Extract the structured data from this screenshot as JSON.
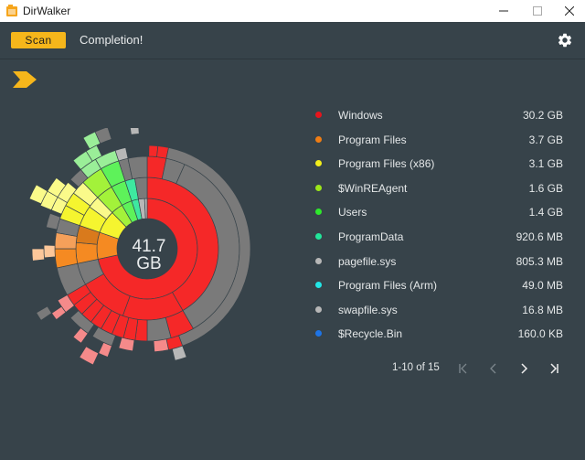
{
  "window": {
    "title": "DirWalker",
    "icon": "dirwalker-app-icon"
  },
  "toolbar": {
    "scan_label": "Scan",
    "status": "Completion!",
    "settings_icon": "gear-icon"
  },
  "center": {
    "total": "41.7",
    "unit": "GB"
  },
  "legend": [
    {
      "name": "Windows",
      "size": "30.2 GB",
      "color": "#e8141c"
    },
    {
      "name": "Program Files",
      "size": "3.7 GB",
      "color": "#f07d14"
    },
    {
      "name": "Program Files (x86)",
      "size": "3.1 GB",
      "color": "#f3ee1b"
    },
    {
      "name": "$WinREAgent",
      "size": "1.6 GB",
      "color": "#9ce61a"
    },
    {
      "name": "Users",
      "size": "1.4 GB",
      "color": "#2ee82c"
    },
    {
      "name": "ProgramData",
      "size": "920.6 MB",
      "color": "#22e69a"
    },
    {
      "name": "pagefile.sys",
      "size": "805.3 MB",
      "color": "#b7b7b7"
    },
    {
      "name": "Program Files (Arm)",
      "size": "49.0 MB",
      "color": "#22e6e6"
    },
    {
      "name": "swapfile.sys",
      "size": "16.8 MB",
      "color": "#b7b7b7"
    },
    {
      "name": "$Recycle.Bin",
      "size": "160.0 KB",
      "color": "#1e74e6"
    }
  ],
  "pager": {
    "range": "1-10 of 15"
  },
  "colors": {
    "accent": "#f6b61b",
    "background": "#37434a"
  }
}
